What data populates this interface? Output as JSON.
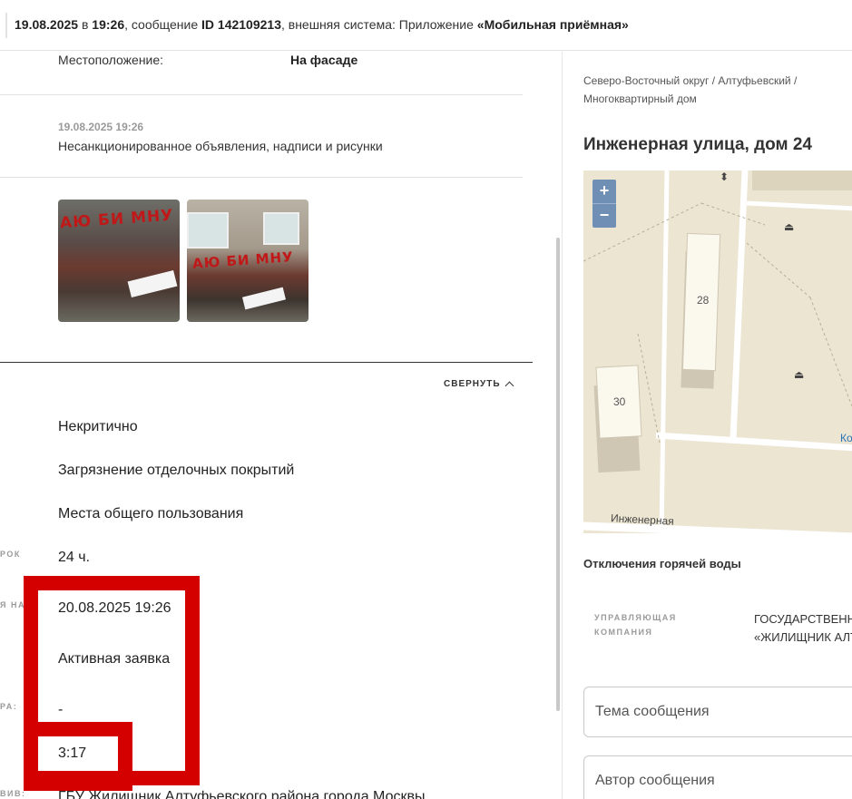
{
  "header": {
    "date": "19.08.2025",
    "at_word": " в ",
    "time": "19:26",
    "message_prefix": ", сообщение ",
    "message_id": "ID 142109213",
    "system_prefix": ", внешняя система: Приложение ",
    "system_name": "«Мобильная приёмная»"
  },
  "location": {
    "label": "Местоположение:",
    "value": "На фасаде"
  },
  "message": {
    "date": "19.08.2025 19:26",
    "text": "Несанкционированное объявления, надписи и рисунки"
  },
  "photos": {
    "graffiti_1": "АЮ БИ МНУ",
    "graffiti_2": "АЮ БИ МНУ"
  },
  "collapse_label": "СВЕРНУТЬ",
  "details": [
    {
      "label": "",
      "value": "Некритично"
    },
    {
      "label": "",
      "value": "Загрязнение отделочных покрытий"
    },
    {
      "label": "",
      "value": "Места общего пользования"
    },
    {
      "label": "РОК",
      "value": "24 ч."
    },
    {
      "label": "Я НА",
      "value": "20.08.2025 19:26"
    },
    {
      "label": "",
      "value": "Активная заявка"
    },
    {
      "label": "РА:",
      "value": "-"
    },
    {
      "label": "",
      "value": "3:17"
    },
    {
      "label": "ВИВ:",
      "value": "ГБУ Жилищник Алтуфьевского района города Москвы"
    }
  ],
  "sidebar": {
    "breadcrumb": "Северо-Восточный округ / Алтуфьевский / Многоквартирный дом",
    "address": "Инженерная улица, дом 24",
    "map": {
      "zoom_in": "+",
      "zoom_out": "−",
      "building_28": "28",
      "building_30": "30",
      "street": "Инженерная",
      "edge_label": "Ко"
    },
    "hot_water": "Отключения горячей воды",
    "management_company": {
      "label_line1": "УПРАВЛЯЮЩАЯ",
      "label_line2": "КОМПАНИЯ",
      "value_line1": "ГОСУДАРСТВЕНН",
      "value_line2": "«ЖИЛИЩНИК АЛТ"
    },
    "subject_placeholder": "Тема сообщения",
    "author_placeholder": "Автор сообщения"
  },
  "colors": {
    "highlight": "#d40000",
    "map_bg": "#ebe5d2",
    "zoom_control": "#6f8fb5"
  }
}
